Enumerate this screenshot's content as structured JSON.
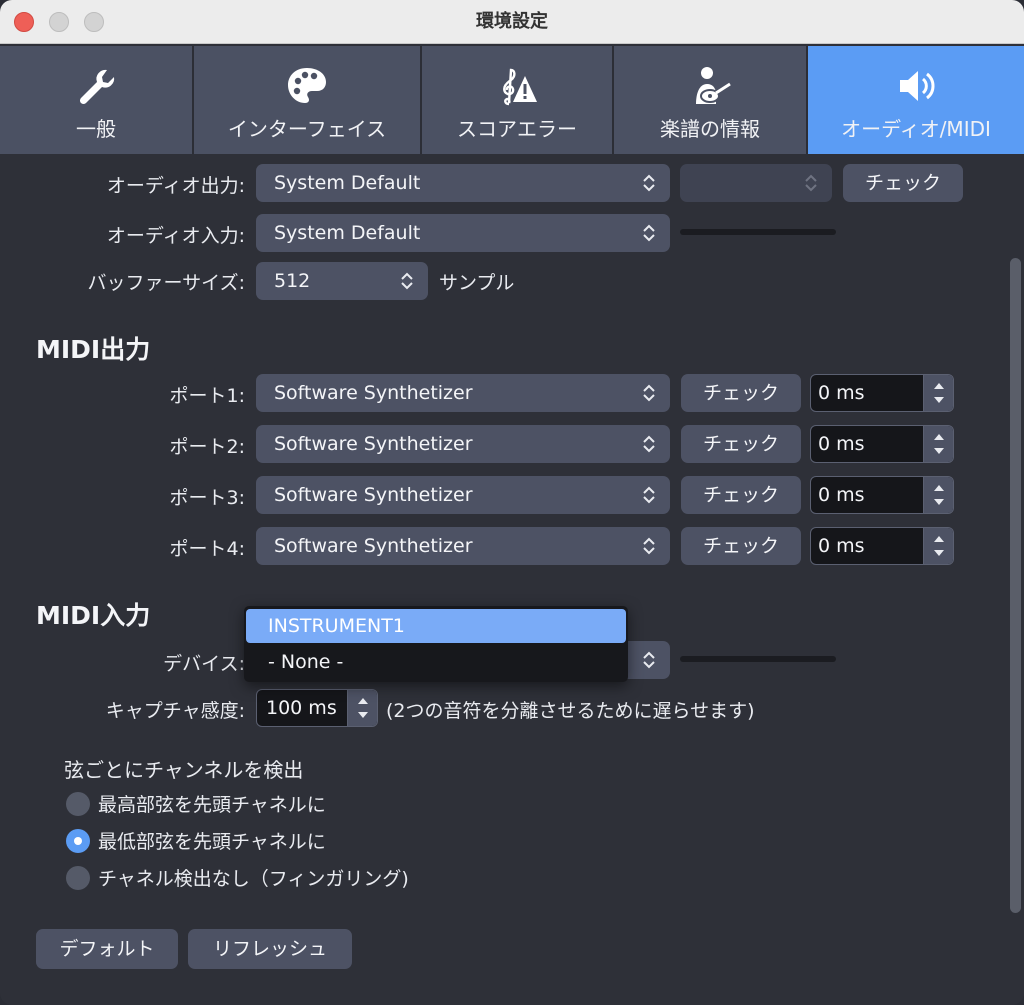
{
  "window": {
    "title": "環境設定"
  },
  "tabs": [
    {
      "label": "一般",
      "icon": "wrench-icon"
    },
    {
      "label": "インターフェイス",
      "icon": "palette-icon"
    },
    {
      "label": "スコアエラー",
      "icon": "clef-warning-icon"
    },
    {
      "label": "楽譜の情報",
      "icon": "guitarist-icon"
    },
    {
      "label": "オーディオ/MIDI",
      "icon": "speaker-icon"
    }
  ],
  "audio": {
    "output_label": "オーディオ出力:",
    "output_value": "System Default",
    "output_check": "チェック",
    "input_label": "オーディオ入力:",
    "input_value": "System Default",
    "buffer_label": "バッファーサイズ:",
    "buffer_value": "512",
    "buffer_unit": "サンプル"
  },
  "midi_out": {
    "title": "MIDI出力",
    "ports": [
      {
        "label": "ポート1:",
        "value": "Software Synthetizer",
        "check": "チェック",
        "delay": "0 ms"
      },
      {
        "label": "ポート2:",
        "value": "Software Synthetizer",
        "check": "チェック",
        "delay": "0 ms"
      },
      {
        "label": "ポート3:",
        "value": "Software Synthetizer",
        "check": "チェック",
        "delay": "0 ms"
      },
      {
        "label": "ポート4:",
        "value": "Software Synthetizer",
        "check": "チェック",
        "delay": "0 ms"
      }
    ]
  },
  "midi_in": {
    "title": "MIDI入力",
    "device_label": "デバイス:",
    "menu_items": [
      "INSTRUMENT1",
      "- None -"
    ],
    "capture_label": "キャプチャ感度:",
    "capture_value": "100 ms",
    "capture_note": "(2つの音符を分離させるために遅らせます)"
  },
  "channels": {
    "title": "弦ごとにチャンネルを検出",
    "options": [
      {
        "label": "最高部弦を先頭チャネルに",
        "selected": false
      },
      {
        "label": "最低部弦を先頭チャネルに",
        "selected": true
      },
      {
        "label": "チャネル検出なし（フィンガリング)",
        "selected": false
      }
    ]
  },
  "footer": {
    "default_label": "デフォルト",
    "refresh_label": "リフレッシュ"
  },
  "colors": {
    "accent": "#5b9cf4",
    "panel": "#2e3038",
    "control": "#4d5264"
  }
}
